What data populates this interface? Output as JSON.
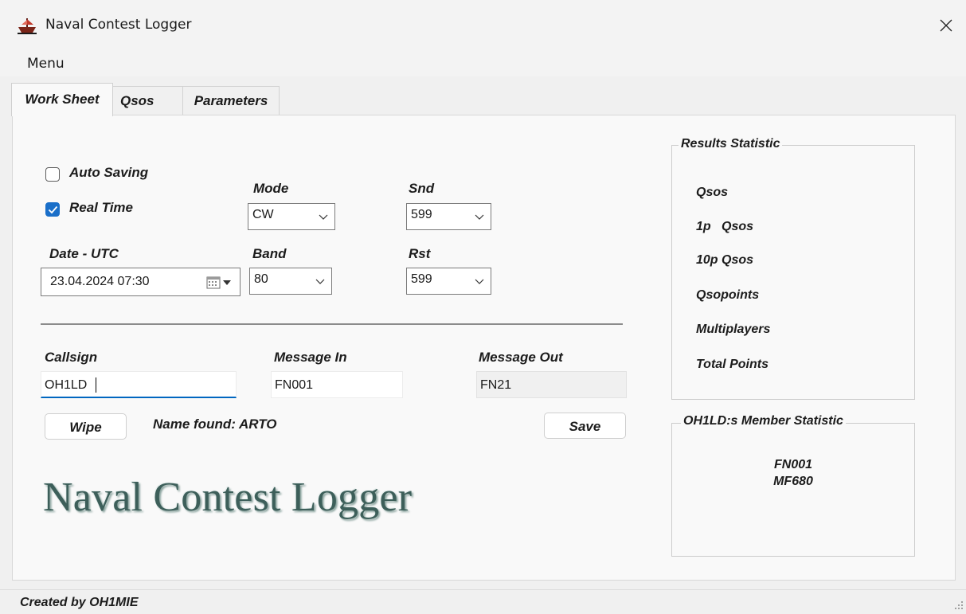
{
  "window": {
    "title": "Naval Contest Logger"
  },
  "menu": {
    "items": [
      "Menu"
    ]
  },
  "tabs": [
    {
      "label": "Work Sheet",
      "active": true
    },
    {
      "label": "Qsos",
      "active": false
    },
    {
      "label": "Parameters",
      "active": false
    }
  ],
  "worksheet": {
    "auto_saving": {
      "label": "Auto Saving",
      "checked": false
    },
    "real_time": {
      "label": "Real Time",
      "checked": true
    },
    "mode": {
      "label": "Mode",
      "value": "CW"
    },
    "snd": {
      "label": "Snd",
      "value": "599"
    },
    "date": {
      "label": "Date - UTC",
      "value": "23.04.2024 07:30"
    },
    "band": {
      "label": "Band",
      "value": "80"
    },
    "rst": {
      "label": "Rst",
      "value": "599"
    },
    "callsign": {
      "label": "Callsign",
      "value": "OH1LD"
    },
    "message_in": {
      "label": "Message In",
      "value": "FN001"
    },
    "message_out": {
      "label": "Message Out",
      "value": "FN21"
    },
    "wipe_label": "Wipe",
    "name_found": "Name found: ARTO",
    "save_label": "Save",
    "logo_text": "Naval Contest Logger"
  },
  "results": {
    "title": "Results Statistic",
    "rows": [
      "Qsos",
      "1p   Qsos",
      "10p Qsos",
      "Qsopoints",
      "Multiplayers",
      "Total Points"
    ]
  },
  "member": {
    "title": "OH1LD:s Member Statistic",
    "lines": [
      "FN001",
      "MF680"
    ]
  },
  "status": {
    "text": "Created by OH1MIE"
  },
  "colors": {
    "accent": "#1a6fc9",
    "focus_underline": "#0067c0",
    "logo": "#3d5f5a",
    "app_icon": "#c0392b"
  },
  "icons": {
    "app": "ship-icon",
    "close": "close-icon",
    "dropdown": "chevron-down-icon",
    "calendar": "calendar-icon",
    "check": "check-icon",
    "grip": "resize-grip-icon"
  }
}
